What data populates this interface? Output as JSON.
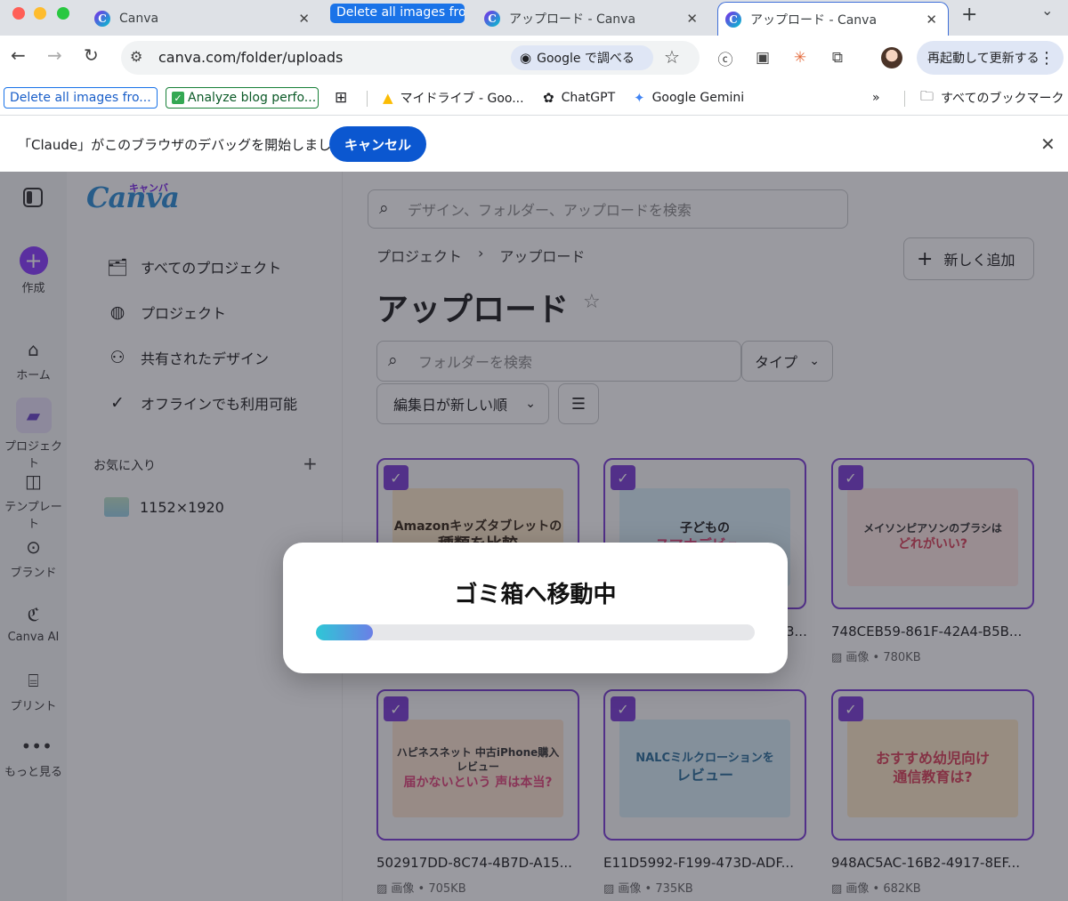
{
  "browser": {
    "tabs": [
      {
        "title": "Canva"
      },
      {
        "title": "アップロード - Canva"
      },
      {
        "title": "アップロード - Canva"
      }
    ],
    "tab_group_label": "Delete all images fro",
    "url": "canva.com/folder/uploads",
    "lens_label": "Google で調べる",
    "update_button": "再起動して更新する",
    "bookmarks": [
      "Delete all images fro...",
      "Analyze blog perfo...",
      "マイドライブ - Goo...",
      "ChatGPT",
      "Google Gemini",
      "すべてのブックマーク"
    ],
    "infobar_text": "「Claude」がこのブラウザのデバッグを開始しました",
    "infobar_cancel": "キャンセル"
  },
  "rail": {
    "items": [
      "作成",
      "ホーム",
      "プロジェクト",
      "テンプレート",
      "ブランド",
      "Canva AI",
      "プリント",
      "もっと見る"
    ]
  },
  "sidepanel": {
    "logo": "Canva",
    "logo_kana": "キャンバ",
    "items": [
      "すべてのプロジェクト",
      "プロジェクト",
      "共有されたデザイン",
      "オフラインでも利用可能"
    ],
    "favorites_label": "お気に入り",
    "favorite_item": "1152×1920"
  },
  "main": {
    "search_placeholder": "デザイン、フォルダー、アップロードを検索",
    "breadcrumb": [
      "プロジェクト",
      "アップロード"
    ],
    "add_new": "新しく追加",
    "title": "アップロード",
    "folder_search_placeholder": "フォルダーを検索",
    "type_filter": "タイプ",
    "sort": "編集日が新しい順",
    "cards": [
      {
        "thumb_line1": "Amazonキッズタブレットの",
        "thumb_line2": "種類を比較",
        "name": "",
        "meta": "",
        "bg": "#fbe7c8"
      },
      {
        "thumb_line1": "子どもの",
        "thumb_line2": "スマホデビュー",
        "name": "",
        "meta": "",
        "bg": "#d9eef7"
      },
      {
        "thumb_line1": "メイソンピアソンのブラシは",
        "thumb_line2": "どれがいい?",
        "name": "748CEB59-861F-42A4-B5B...",
        "meta": "画像 • 780KB",
        "bg": "#fde7e4"
      },
      {
        "thumb_line1": "ハピネスネット 中古iPhone購入レビュー",
        "thumb_line2": "届かないという 声は本当?",
        "name": "502917DD-8C74-4B7D-A15...",
        "meta": "画像 • 705KB",
        "bg": "#fbe3cf"
      },
      {
        "thumb_line1": "NALCミルクローションを",
        "thumb_line2": "レビュー",
        "name": "E11D5992-F199-473D-ADF...",
        "meta": "画像 • 735KB",
        "bg": "#d7edf6"
      },
      {
        "thumb_line1": "おすすめ幼児向け",
        "thumb_line2": "通信教育は?",
        "name": "948AC5AC-16B2-4917-8EF...",
        "meta": "画像 • 682KB",
        "bg": "#fbe8c6"
      }
    ],
    "partial_name_suffix": "3..."
  },
  "modal": {
    "title": "ゴミ箱へ移動中",
    "progress": 0.13
  },
  "colors": {
    "accent": "#7d3fd6",
    "chrome_blue": "#0b57d0",
    "overlay": "rgba(30,32,45,0.45)"
  }
}
